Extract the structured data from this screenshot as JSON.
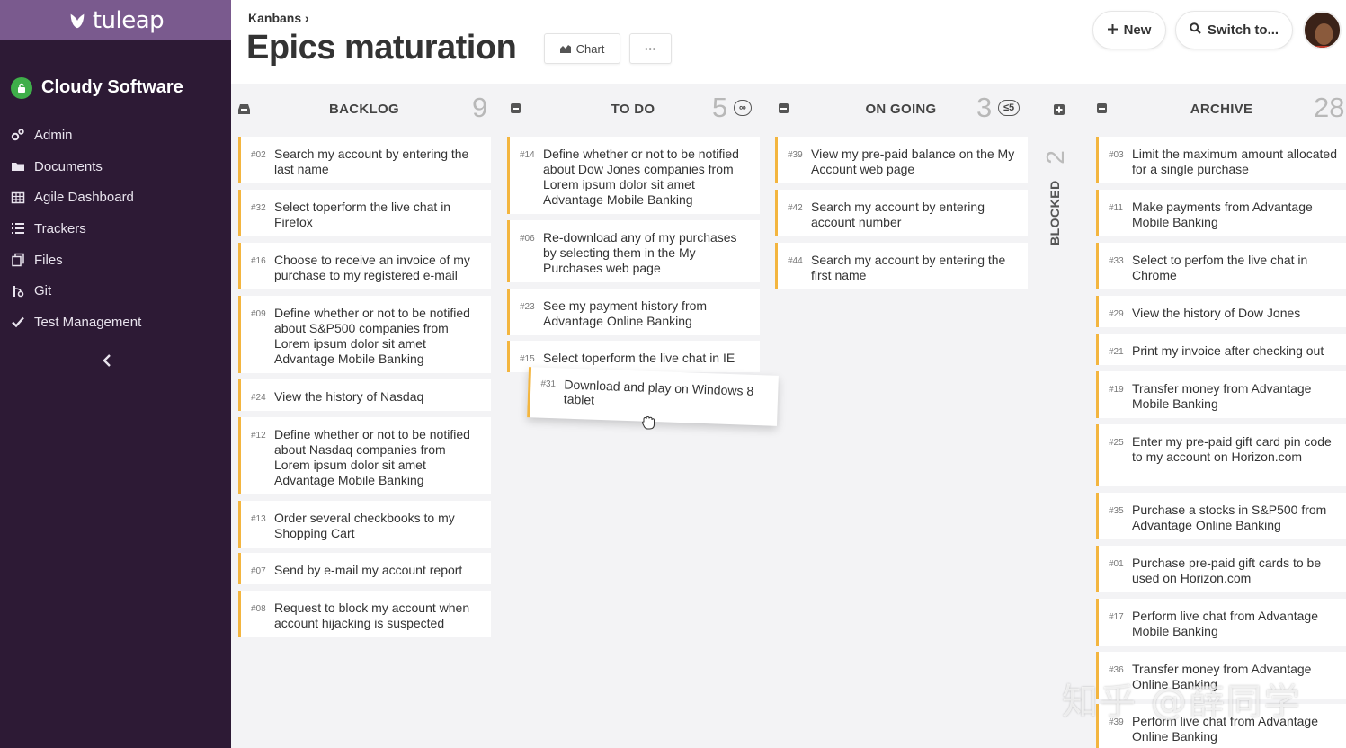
{
  "sidebar": {
    "brand": "tuleap",
    "project": "Cloudy Software",
    "items": [
      {
        "label": "Admin",
        "icon": "gears-icon"
      },
      {
        "label": "Documents",
        "icon": "folder-icon"
      },
      {
        "label": "Agile Dashboard",
        "icon": "table-icon"
      },
      {
        "label": "Trackers",
        "icon": "list-icon"
      },
      {
        "label": "Files",
        "icon": "files-icon"
      },
      {
        "label": "Git",
        "icon": "git-icon"
      },
      {
        "label": "Test Management",
        "icon": "check-icon"
      }
    ]
  },
  "header": {
    "breadcrumb": "Kanbans ›",
    "title": "Epics maturation",
    "chart_label": "Chart",
    "more_label": "···",
    "new_label": "New",
    "switch_label": "Switch to..."
  },
  "columns": {
    "backlog": {
      "title": "BACKLOG",
      "count": "9",
      "cards": [
        {
          "id": "#02",
          "label": "Search my account by entering the last name"
        },
        {
          "id": "#32",
          "label": "Select toperform the live chat in Firefox"
        },
        {
          "id": "#16",
          "label": "Choose to receive an invoice of my purchase to my registered e-mail"
        },
        {
          "id": "#09",
          "label": "Define whether or not to be notified about S&P500 companies from Lorem ipsum dolor sit amet Advantage Mobile Banking"
        },
        {
          "id": "#24",
          "label": "View the history of Nasdaq"
        },
        {
          "id": "#12",
          "label": "Define whether or not to be notified about Nasdaq companies from Lorem ipsum dolor sit amet Advantage Mobile Banking"
        },
        {
          "id": "#13",
          "label": "Order several checkbooks to my Shopping Cart"
        },
        {
          "id": "#07",
          "label": "Send by e-mail my account report"
        },
        {
          "id": "#08",
          "label": "Request to block my account when account hijacking is suspected"
        }
      ]
    },
    "todo": {
      "title": "TO DO",
      "count": "5",
      "wip": "∞",
      "cards": [
        {
          "id": "#14",
          "label": "Define whether or not to be notified about Dow Jones companies from Lorem ipsum dolor sit amet Advantage Mobile Banking"
        },
        {
          "id": "#06",
          "label": "Re-download any of my purchases by selecting them in the My Purchases web page"
        },
        {
          "id": "#23",
          "label": "See my payment history from Advantage Online Banking"
        },
        {
          "id": "#15",
          "label": "Select toperform the live chat in IE"
        }
      ],
      "dragging": {
        "id": "#31",
        "label": "Download and play on Windows 8 tablet"
      }
    },
    "ongoing": {
      "title": "ON GOING",
      "count": "3",
      "wip": "≤5",
      "cards": [
        {
          "id": "#39",
          "label": "View my pre-paid balance on the My Account web page"
        },
        {
          "id": "#42",
          "label": "Search my account by entering account number"
        },
        {
          "id": "#44",
          "label": "Search my account by entering the first name"
        }
      ]
    },
    "blocked": {
      "title": "BLOCKED",
      "count": "2"
    },
    "archive": {
      "title": "ARCHIVE",
      "count": "28",
      "cards": [
        {
          "id": "#03",
          "label": "Limit the maximum amount allocated for a single purchase"
        },
        {
          "id": "#11",
          "label": "Make payments from Advantage Mobile Banking"
        },
        {
          "id": "#33",
          "label": "Select to perfom the live chat in Chrome"
        },
        {
          "id": "#29",
          "label": "View the history of Dow Jones"
        },
        {
          "id": "#21",
          "label": "Print my invoice after checking out"
        },
        {
          "id": "#19",
          "label": "Transfer money from Advantage Mobile Banking"
        },
        {
          "id": "#25",
          "label": "Enter my pre-paid gift card pin code to my account on Horizon.com"
        },
        {
          "id": "#35",
          "label": "Purchase a stocks in S&P500 from Advantage Online Banking"
        },
        {
          "id": "#01",
          "label": "Purchase pre-paid gift cards to be used on Horizon.com"
        },
        {
          "id": "#17",
          "label": "Perform live chat from Advantage Mobile Banking"
        },
        {
          "id": "#36",
          "label": "Transfer money from Advantage Online Banking"
        },
        {
          "id": "#39",
          "label": "Perform live chat from Advantage Online Banking"
        }
      ]
    }
  },
  "watermark": "知乎 @薛同学",
  "colors": {
    "sidebar": "#2d1a35",
    "brand": "#7a5a8e",
    "card_accent": "#f3b53f",
    "project_icon": "#3fae4a"
  }
}
